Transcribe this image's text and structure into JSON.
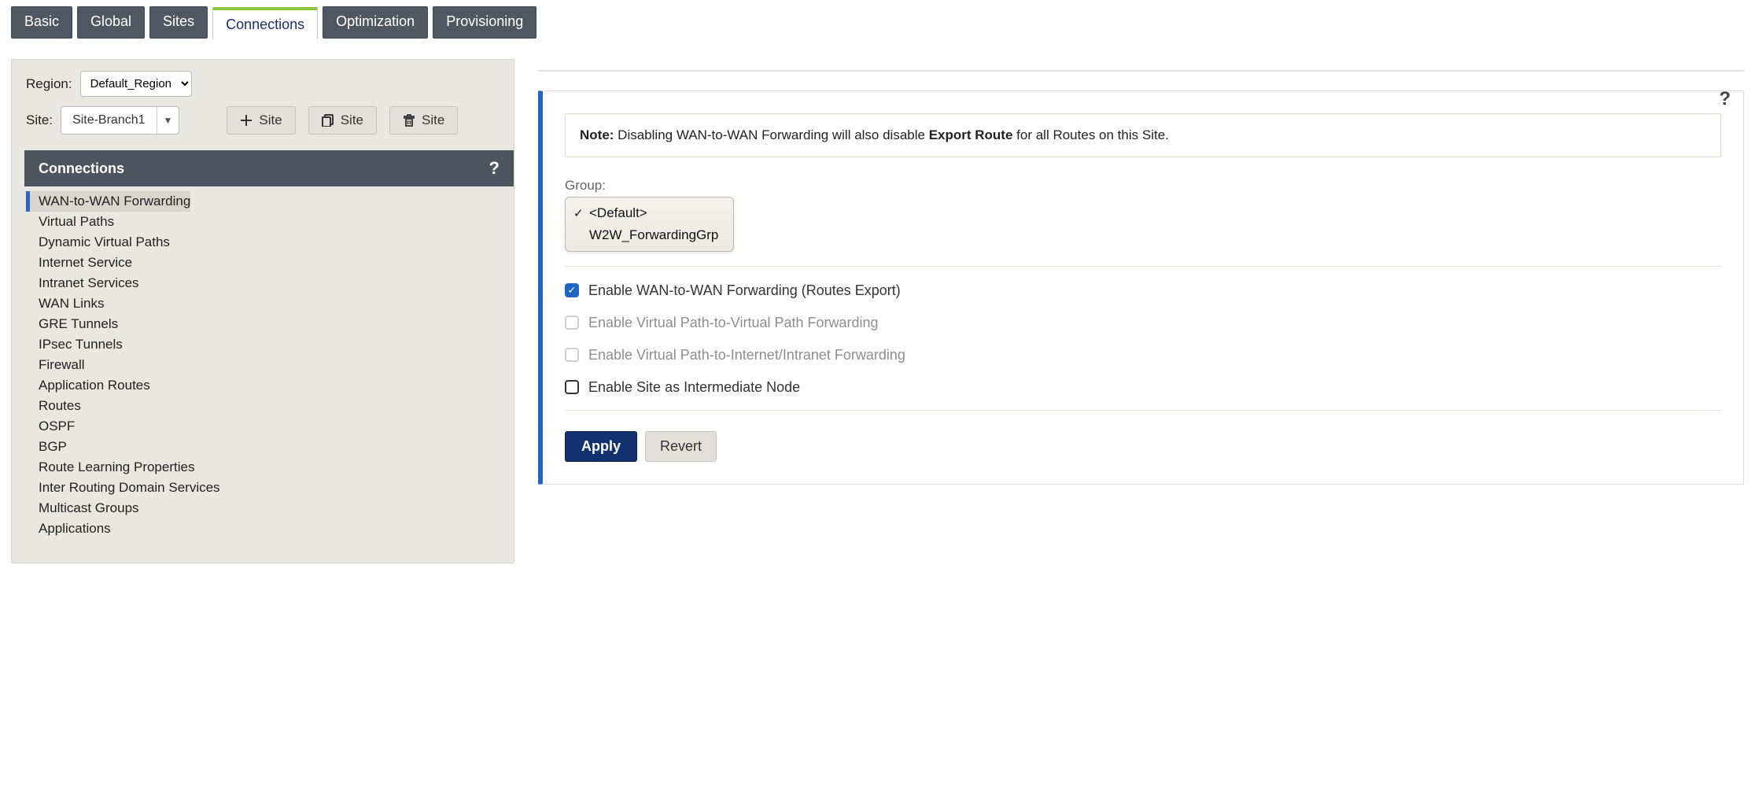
{
  "tabs": {
    "basic": "Basic",
    "global": "Global",
    "sites": "Sites",
    "connections": "Connections",
    "optimization": "Optimization",
    "provisioning": "Provisioning"
  },
  "left": {
    "regionLabel": "Region:",
    "regionValue": "Default_Region",
    "siteLabel": "Site:",
    "siteValue": "Site-Branch1",
    "addSite": "Site",
    "cloneSite": "Site",
    "deleteSite": "Site",
    "sectionTitle": "Connections",
    "helpGlyph": "?",
    "tree": [
      "WAN-to-WAN Forwarding",
      "Virtual Paths",
      "Dynamic Virtual Paths",
      "Internet Service",
      "Intranet Services",
      "WAN Links",
      "GRE Tunnels",
      "IPsec Tunnels",
      "Firewall",
      "Application Routes",
      "Routes",
      "OSPF",
      "BGP",
      "Route Learning Properties",
      "Inter Routing Domain Services",
      "Multicast Groups",
      "Applications"
    ]
  },
  "right": {
    "helpGlyph": "?",
    "noteBold1": "Note:",
    "noteText1": " Disabling WAN-to-WAN Forwarding will also disable ",
    "noteBold2": "Export Route",
    "noteText2": " for all Routes on this Site.",
    "groupLabel": "Group:",
    "groupOptions": [
      "<Default>",
      "W2W_ForwardingGrp"
    ],
    "groupSelectedIndex": 0,
    "check1": "Enable WAN-to-WAN Forwarding (Routes Export)",
    "check2": "Enable Virtual Path-to-Virtual Path Forwarding",
    "check3": "Enable Virtual Path-to-Internet/Intranet Forwarding",
    "check4": "Enable Site as Intermediate Node",
    "apply": "Apply",
    "revert": "Revert"
  }
}
